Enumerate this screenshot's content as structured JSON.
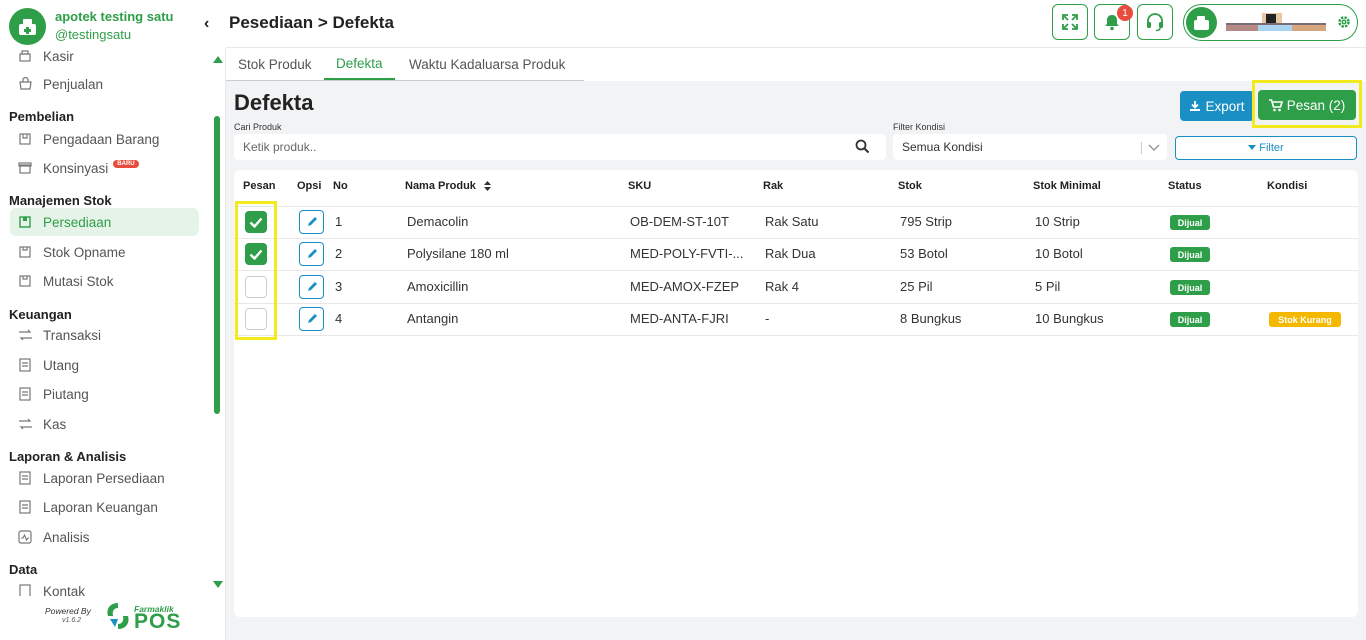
{
  "sidebar": {
    "app_name": "apotek testing satu",
    "handle": "@testingsatu",
    "items": {
      "kasir": "Kasir",
      "penjualan": "Penjualan",
      "pengadaan": "Pengadaan Barang",
      "konsinyasi": "Konsinyasi",
      "konsinyasi_badge": "BARU",
      "persediaan": "Persediaan",
      "stok_opname": "Stok Opname",
      "mutasi_stok": "Mutasi Stok",
      "transaksi": "Transaksi",
      "utang": "Utang",
      "piutang": "Piutang",
      "kas": "Kas",
      "laporan_persediaan": "Laporan Persediaan",
      "laporan_keuangan": "Laporan Keuangan",
      "analisis": "Analisis",
      "kontak": "Kontak"
    },
    "groups": {
      "pembelian": "Pembelian",
      "manajemen_stok": "Manajemen Stok",
      "keuangan": "Keuangan",
      "laporan": "Laporan & Analisis",
      "data": "Data"
    },
    "footer": {
      "powered_by": "Powered By",
      "version": "v1.6.2",
      "brand_small": "Farmaklik",
      "brand_big": "POS"
    }
  },
  "header": {
    "breadcrumb": "Pesediaan > Defekta",
    "notification_count": "1"
  },
  "tabs": [
    "Stok Produk",
    "Defekta",
    "Waktu Kadaluarsa Produk"
  ],
  "main": {
    "title": "Defekta",
    "export_label": "Export",
    "pesan_label": "Pesan (2)",
    "search_label": "Cari Produk",
    "search_placeholder": "Ketik produk..",
    "filter_label": "Filter Kondisi",
    "filter_value": "Semua Kondisi",
    "filter_button": "Filter"
  },
  "table": {
    "headers": {
      "pesan": "Pesan",
      "opsi": "Opsi",
      "no": "No",
      "nama": "Nama Produk",
      "sku": "SKU",
      "rak": "Rak",
      "stok": "Stok",
      "stok_min": "Stok Minimal",
      "status": "Status",
      "kondisi": "Kondisi"
    },
    "rows": [
      {
        "checked": true,
        "no": "1",
        "nama": "Demacolin",
        "sku": "OB-DEM-ST-10T",
        "rak": "Rak Satu",
        "stok": "795 Strip",
        "stok_min": "10 Strip",
        "status": "Dijual",
        "kondisi": ""
      },
      {
        "checked": true,
        "no": "2",
        "nama": "Polysilane 180 ml",
        "sku": "MED-POLY-FVTI-...",
        "rak": "Rak Dua",
        "stok": "53 Botol",
        "stok_min": "10 Botol",
        "status": "Dijual",
        "kondisi": ""
      },
      {
        "checked": false,
        "no": "3",
        "nama": "Amoxicillin",
        "sku": "MED-AMOX-FZEP",
        "rak": "Rak 4",
        "stok": "25 Pil",
        "stok_min": "5 Pil",
        "status": "Dijual",
        "kondisi": ""
      },
      {
        "checked": false,
        "no": "4",
        "nama": "Antangin",
        "sku": "MED-ANTA-FJRI",
        "rak": "-",
        "stok": "8 Bungkus",
        "stok_min": "10 Bungkus",
        "status": "Dijual",
        "kondisi": "Stok Kurang"
      }
    ]
  },
  "colors": {
    "primary": "#2e9e48",
    "info": "#1a8fc4",
    "warning": "#f5b800",
    "highlight": "#f3ea1e"
  }
}
